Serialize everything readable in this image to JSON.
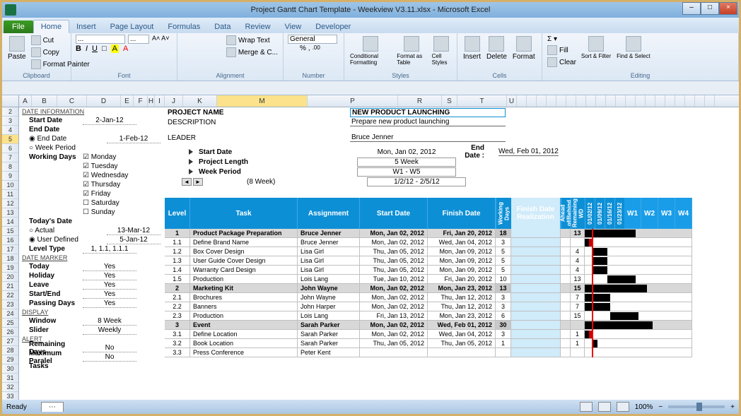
{
  "window": {
    "title": "Project Gantt Chart Template - Weekview V3.11.xlsx - Microsoft Excel"
  },
  "tabs": {
    "file": "File",
    "home": "Home",
    "insert": "Insert",
    "pagelayout": "Page Layout",
    "formulas": "Formulas",
    "data": "Data",
    "review": "Review",
    "view": "View",
    "developer": "Developer"
  },
  "ribbon": {
    "clipboard": {
      "paste": "Paste",
      "cut": "Cut",
      "copy": "Copy",
      "fp": "Format Painter",
      "label": "Clipboard"
    },
    "font": {
      "label": "Font",
      "name": "...",
      "size": "..."
    },
    "alignment": {
      "label": "Alignment",
      "wrap": "Wrap Text",
      "merge": "Merge & C..."
    },
    "number": {
      "label": "Number",
      "general": "General"
    },
    "styles": {
      "label": "Styles",
      "cond": "Conditional Formatting",
      "fmt": "Format as Table",
      "cell": "Cell Styles"
    },
    "cells": {
      "label": "Cells",
      "ins": "Insert",
      "del": "Delete",
      "fmt": "Format"
    },
    "editing": {
      "label": "Editing",
      "fill": "Fill",
      "clear": "Clear",
      "sort": "Sort & Filter",
      "find": "Find & Select"
    }
  },
  "cols": [
    "A",
    "B",
    "C",
    "D",
    "E",
    "F",
    "H",
    "I",
    "J",
    "K",
    "M",
    "P",
    "R",
    "S",
    "T",
    "U"
  ],
  "date_info": {
    "header": "DATE INFORMATION",
    "start": {
      "lbl": "Start Date",
      "val": "2-Jan-12"
    },
    "end": {
      "lbl": "End Date",
      "val": ""
    },
    "end_radio": "End Date",
    "end_radio_val": "1-Feb-12",
    "week_radio": "Week Period",
    "working": "Working Days",
    "days": {
      "mon": "Monday",
      "tue": "Tuesday",
      "wed": "Wednesday",
      "thu": "Thursday",
      "fri": "Friday",
      "sat": "Saturday",
      "sun": "Sunday"
    },
    "today": "Today's Date",
    "actual": "Actual",
    "actual_val": "13-Mar-12",
    "user_def": "User Defined",
    "user_def_val": "5-Jan-12",
    "level_type": "Level Type",
    "level_type_val": "1, 1.1, 1.1.1"
  },
  "marker": {
    "header": "DATE MARKER",
    "today": {
      "lbl": "Today",
      "val": "Yes"
    },
    "holiday": {
      "lbl": "Holiday",
      "val": "Yes"
    },
    "leave": {
      "lbl": "Leave",
      "val": "Yes"
    },
    "startend": {
      "lbl": "Start/End",
      "val": "Yes"
    },
    "passing": {
      "lbl": "Passing Days",
      "val": "Yes"
    }
  },
  "display": {
    "header": "DISPLAY",
    "window": {
      "lbl": "Window",
      "val": "8 Week"
    },
    "slider": {
      "lbl": "Slider",
      "val": "Weekly"
    }
  },
  "alert": {
    "header": "ALERT",
    "remaining": {
      "lbl": "Remaining Days",
      "val": "No"
    },
    "parallel": {
      "lbl": "Maximum Paralel",
      "val": "No"
    },
    "tasks": {
      "lbl": "Tasks",
      "val": ""
    }
  },
  "project": {
    "name_lbl": "PROJECT NAME",
    "name": "NEW PRODUCT LAUNCHING",
    "desc_lbl": "DESCRIPTION",
    "desc": "Prepare new product launching",
    "leader_lbl": "LEADER",
    "leader": "Bruce Jenner",
    "start_lbl": "Start Date",
    "start": "Mon, Jan 02, 2012",
    "end_lbl": "End Date :",
    "end": "Wed, Feb 01, 2012",
    "length_lbl": "Project Length",
    "length": "5 Week",
    "period_lbl": "Week Period",
    "period": "W1 - W5",
    "weeks_lbl": "(8 Week)",
    "weeks": "1/2/12 - 2/5/12"
  },
  "gantt_headers": {
    "level": "Level",
    "task": "Task",
    "assign": "Assignment",
    "start": "Start Date",
    "finish": "Finish Date",
    "wd": "Working Days",
    "fdr": "Finish Date Realization",
    "ahead": "Ahead of/Behind",
    "rem": "Remaining WD",
    "d1": "01/02/12",
    "d2": "01/09/12",
    "d3": "01/16/12",
    "d4": "01/23/12",
    "w1": "W1",
    "w2": "W2",
    "w3": "W3",
    "w4": "W4"
  },
  "gantt_rows": [
    {
      "g": true,
      "level": "1",
      "task": "Product Package Preparation",
      "assign": "Bruce Jenner",
      "start": "Mon, Jan 02, 2012",
      "finish": "Fri, Jan 20, 2012",
      "wd": "18",
      "rem": "13"
    },
    {
      "level": "1.1",
      "task": "Define Brand Name",
      "assign": "Bruce Jenner",
      "start": "Mon, Jan 02, 2012",
      "finish": "Wed, Jan 04, 2012",
      "wd": "3",
      "rem": ""
    },
    {
      "level": "1.2",
      "task": "Box Cover Design",
      "assign": "Lisa Girl",
      "start": "Thu, Jan 05, 2012",
      "finish": "Mon, Jan 09, 2012",
      "wd": "5",
      "rem": "4"
    },
    {
      "level": "1.3",
      "task": "User Guide Cover Design",
      "assign": "Lisa Girl",
      "start": "Thu, Jan 05, 2012",
      "finish": "Mon, Jan 09, 2012",
      "wd": "5",
      "rem": "4"
    },
    {
      "level": "1.4",
      "task": "Warranty Card Design",
      "assign": "Lisa Girl",
      "start": "Thu, Jan 05, 2012",
      "finish": "Mon, Jan 09, 2012",
      "wd": "5",
      "rem": "4"
    },
    {
      "level": "1.5",
      "task": "Production",
      "assign": "Lois Lang",
      "start": "Tue, Jan 10, 2012",
      "finish": "Fri, Jan 20, 2012",
      "wd": "10",
      "rem": "13"
    },
    {
      "g": true,
      "level": "2",
      "task": "Marketing Kit",
      "assign": "John Wayne",
      "start": "Mon, Jan 02, 2012",
      "finish": "Mon, Jan 23, 2012",
      "wd": "13",
      "rem": "15"
    },
    {
      "level": "2.1",
      "task": "Brochures",
      "assign": "John Wayne",
      "start": "Mon, Jan 02, 2012",
      "finish": "Thu, Jan 12, 2012",
      "wd": "3",
      "rem": "7"
    },
    {
      "level": "2.2",
      "task": "Banners",
      "assign": "John Harper",
      "start": "Mon, Jan 02, 2012",
      "finish": "Thu, Jan 12, 2012",
      "wd": "3",
      "rem": "7"
    },
    {
      "level": "2.3",
      "task": "Production",
      "assign": "Lois Lang",
      "start": "Fri, Jan 13, 2012",
      "finish": "Mon, Jan 23, 2012",
      "wd": "6",
      "rem": "15"
    },
    {
      "g": true,
      "level": "3",
      "task": "Event",
      "assign": "Sarah Parker",
      "start": "Mon, Jan 02, 2012",
      "finish": "Wed, Feb 01, 2012",
      "wd": "30",
      "rem": ""
    },
    {
      "level": "3.1",
      "task": "Define Location",
      "assign": "Sarah Parker",
      "start": "Mon, Jan 02, 2012",
      "finish": "Wed, Jan 04, 2012",
      "wd": "3",
      "rem": "1"
    },
    {
      "level": "3.2",
      "task": "Book Location",
      "assign": "Sarah Parker",
      "start": "Thu, Jan 05, 2012",
      "finish": "Thu, Jan 05, 2012",
      "wd": "1",
      "rem": "1"
    },
    {
      "level": "3.3",
      "task": "Press Conference",
      "assign": "Peter Kent",
      "start": "",
      "finish": "",
      "wd": "",
      "rem": ""
    }
  ],
  "statusbar": {
    "ready": "Ready",
    "zoom": "100%"
  }
}
